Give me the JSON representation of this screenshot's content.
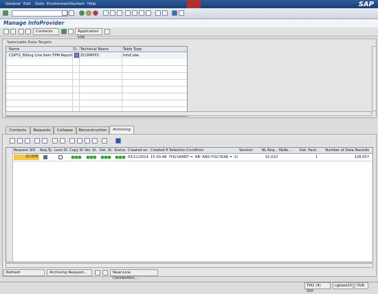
{
  "menu": [
    "General",
    "Edit",
    "Goto",
    "Environment",
    "System",
    "Help"
  ],
  "brand": "SAP",
  "title": "Manage InfoProvider",
  "toolbar2": {
    "contents": "Contents",
    "app_log": "Application Log"
  },
  "targets": {
    "group_title": "Selectable Data Targets",
    "headers": [
      "Name",
      "D..",
      "Technical Name",
      "Table Type"
    ],
    "row": {
      "name": "COPY2_Billing Line Item FPM Reportin",
      "technical": "ZCOPAFP2",
      "type": "InfoCube"
    }
  },
  "tabs": [
    "Contents",
    "Requests",
    "Collapse",
    "Reconstruction",
    "Archiving"
  ],
  "requests": {
    "headers": [
      "Request SID",
      "Req.Ty..",
      "Lock.St.",
      "Copy St.",
      "Ver. St.",
      "Del. St.",
      "Status",
      "Created on",
      "Created At",
      "Selection Condition",
      "Session",
      "NL Req...",
      "NLRe...",
      "Dat. Pack.",
      "Number of Data Records"
    ],
    "row": {
      "sid": "32,008",
      "created_on": "03/11/2014",
      "created_at": "15:30:48",
      "condition": "FISCVARNT = 'AB' AND FISCYEAR = '2013'",
      "nl_req": "32,010",
      "dat_pack": "1",
      "records": "328,057"
    }
  },
  "bottom": {
    "refresh": "Refresh",
    "archiving": "Archiving Request...",
    "nearline": "Near-Line Connection..."
  },
  "statusbar": {
    "system": "TW1 (4) 500",
    "server": "cgbwai20",
    "mode": "OVR"
  }
}
